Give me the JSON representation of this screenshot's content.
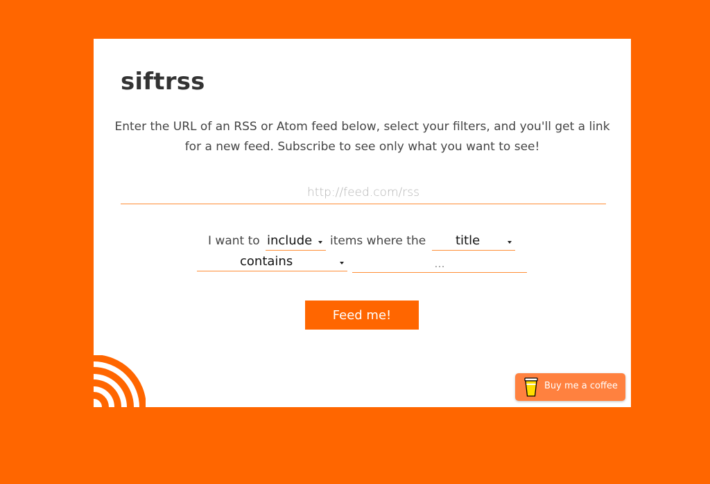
{
  "app": {
    "title": "siftrss",
    "intro": "Enter the URL of an RSS or Atom feed below, select your filters, and you'll get a link for a new feed. Subscribe to see only what you want to see!"
  },
  "feed_url": {
    "placeholder": "http://feed.com/rss",
    "value": ""
  },
  "filter": {
    "prefix": "I want to",
    "action_selected": "include",
    "middle": "items where the",
    "field_selected": "title",
    "operator_selected": "contains",
    "value_placeholder": "...",
    "value": ""
  },
  "submit_label": "Feed me!",
  "coffee_label": "Buy me a coffee",
  "colors": {
    "background": "#ff6600",
    "accent": "#ff6600",
    "coffee_button": "#ff813f",
    "underline": "#ff8c33"
  },
  "icons": [
    "caret-down-icon",
    "rss-icon",
    "coffee-cup-icon"
  ]
}
